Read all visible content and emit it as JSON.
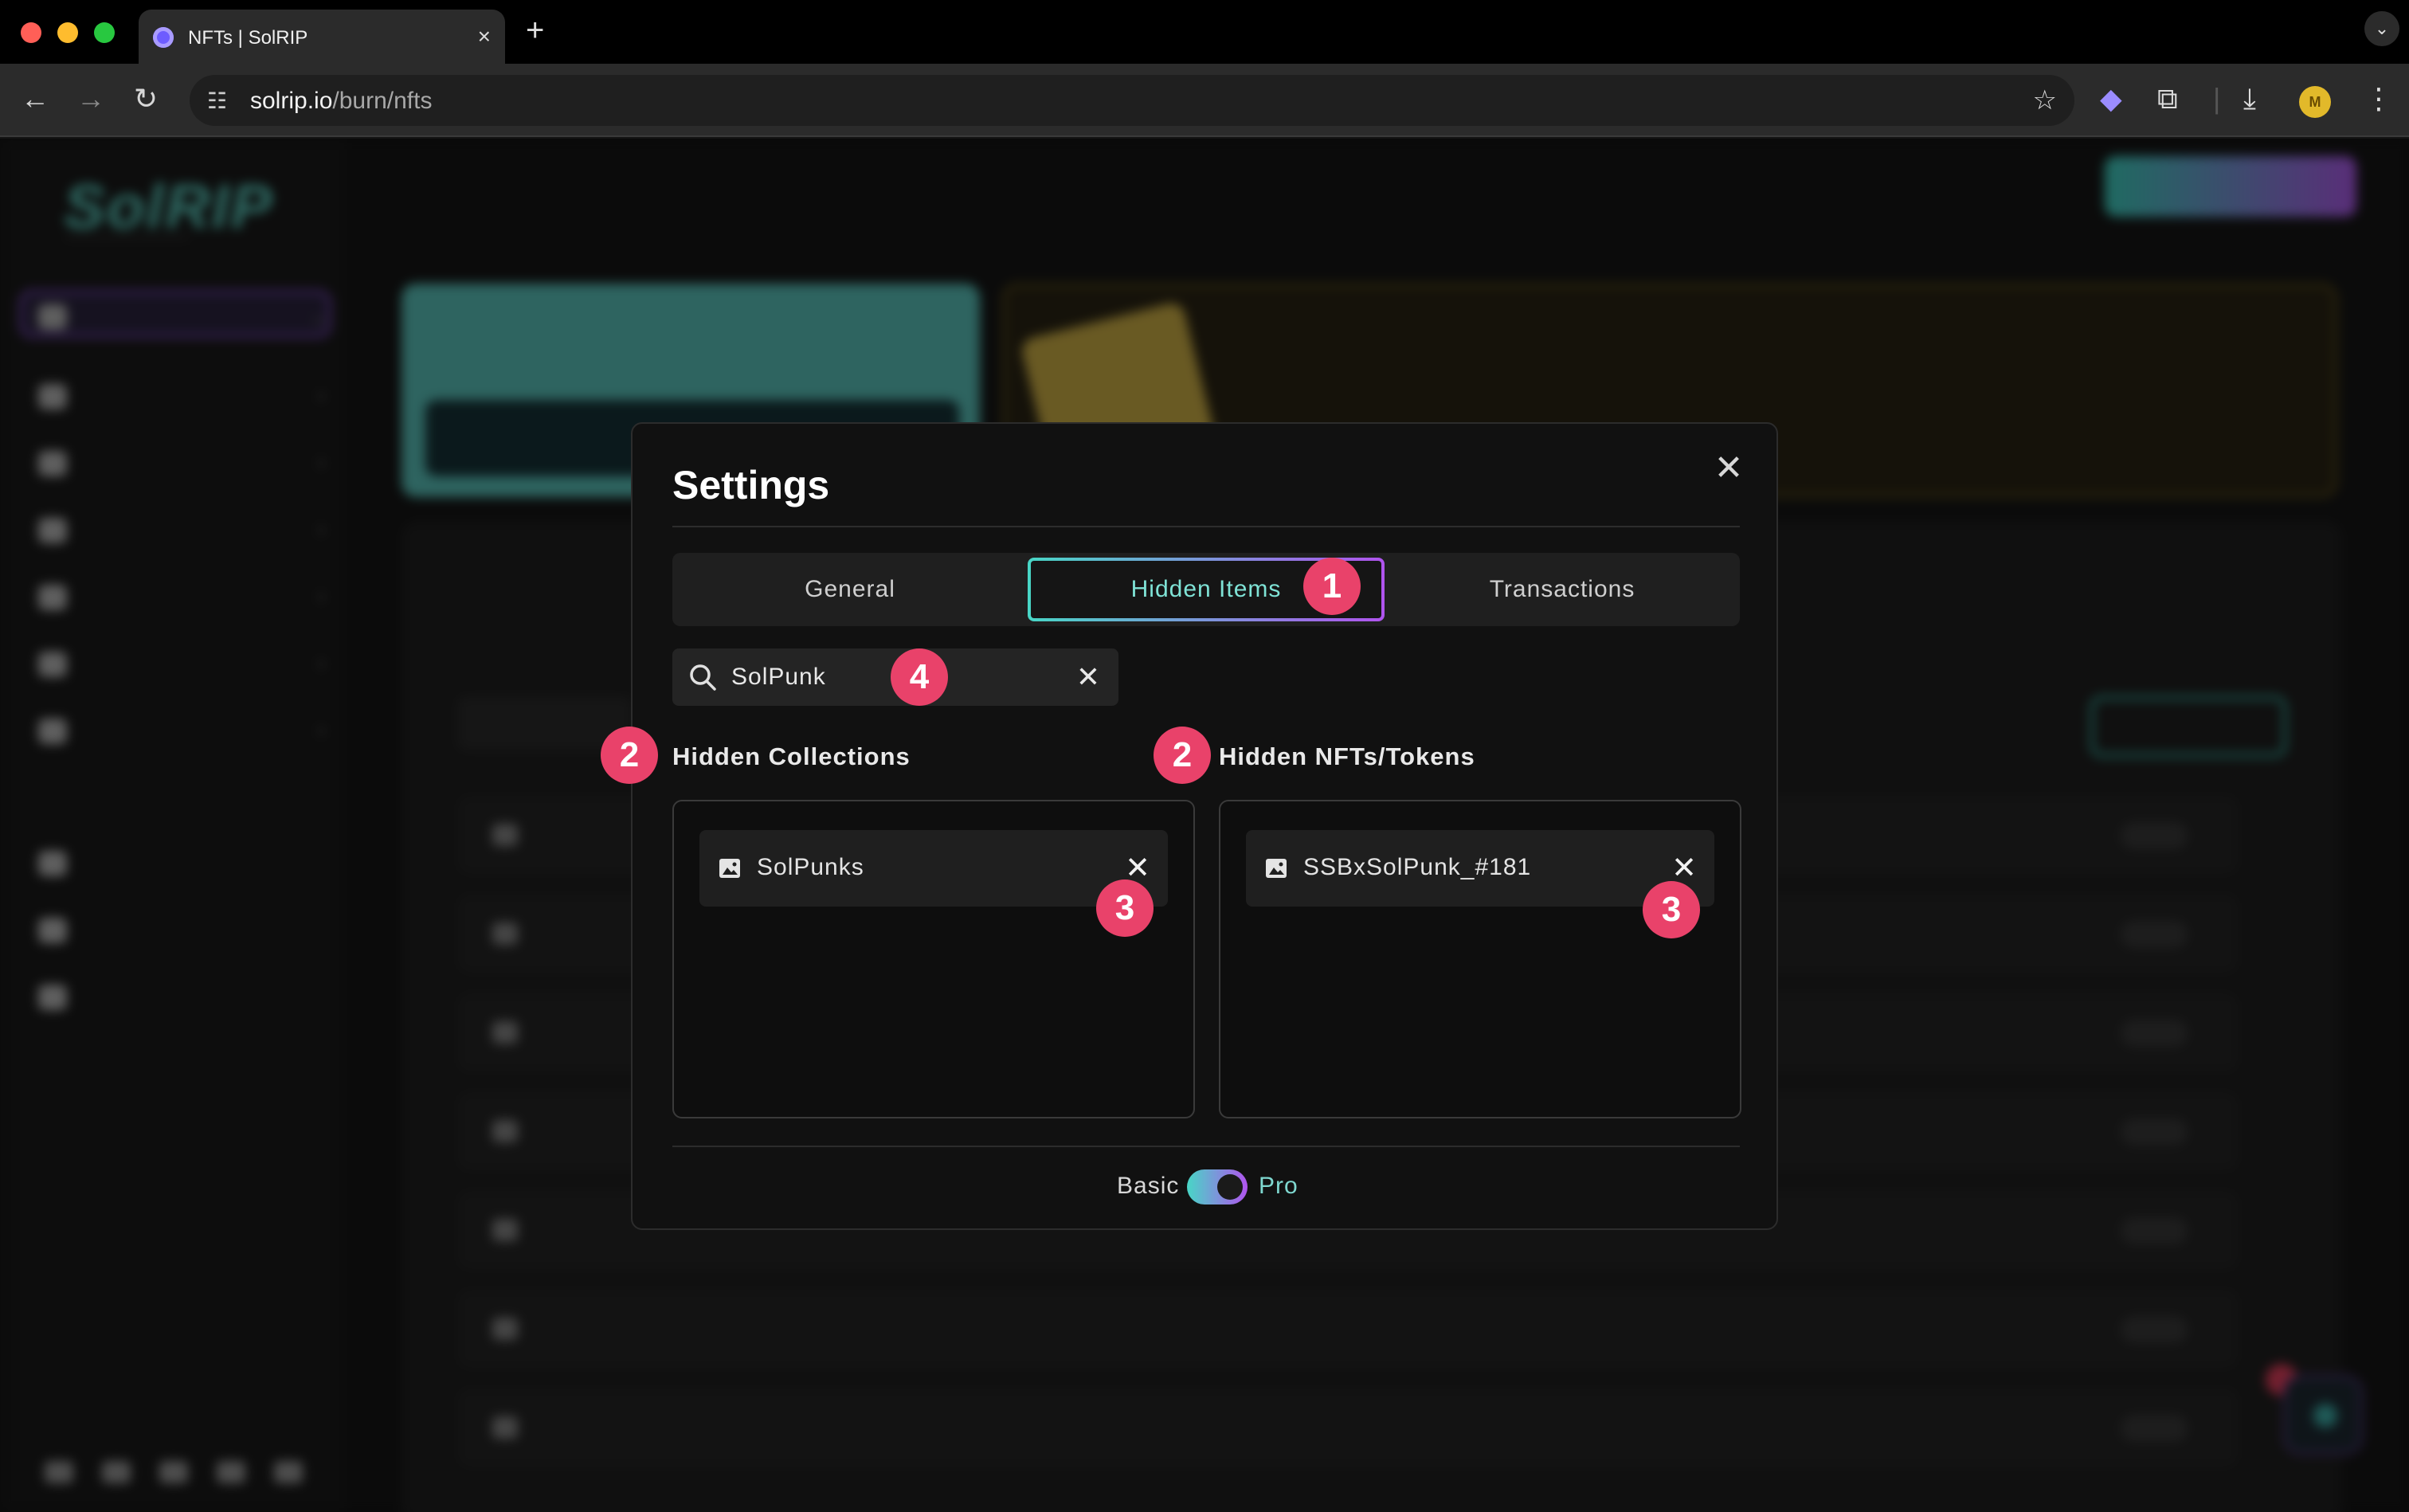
{
  "browser": {
    "tab_title": "NFTs | SolRIP",
    "tab_close": "×",
    "new_tab": "+",
    "url_host": "solrip.io",
    "url_path": "/burn/nfts"
  },
  "icons": {
    "back": "arrow-left-icon",
    "forward": "arrow-right-icon",
    "reload": "reload-icon",
    "site_settings": "tune-icon",
    "bookmark": "star-icon",
    "search": "search-icon",
    "close": "close-icon",
    "image": "image-icon"
  },
  "colors": {
    "accent_teal": "#48d6c6",
    "accent_purple": "#b054ee",
    "badge": "#e9426a",
    "modal_bg": "#111111"
  },
  "modal": {
    "title": "Settings",
    "close_glyph": "✕",
    "tabs": [
      {
        "label": "General",
        "active": false
      },
      {
        "label": "Hidden Items",
        "active": true
      },
      {
        "label": "Transactions",
        "active": false
      }
    ],
    "search": {
      "value": "SolPunk",
      "clear_glyph": "✕"
    },
    "collections": {
      "heading": "Hidden Collections",
      "items": [
        {
          "label": "SolPunks",
          "remove_glyph": "✕"
        }
      ]
    },
    "nfts": {
      "heading": "Hidden NFTs/Tokens",
      "items": [
        {
          "label": "SSBxSolPunk_#181",
          "remove_glyph": "✕"
        }
      ]
    },
    "mode": {
      "left_label": "Basic",
      "right_label": "Pro",
      "pro_enabled": true
    }
  },
  "annotations": {
    "tabs_step": "1",
    "headings_step": "2",
    "remove_step": "3",
    "search_step": "4"
  }
}
